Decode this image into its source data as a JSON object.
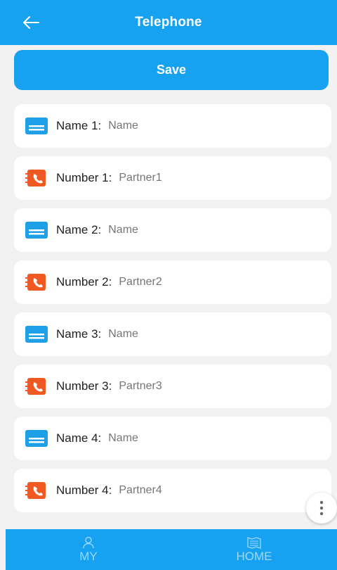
{
  "header": {
    "title": "Telephone",
    "back_icon": "arrow-left-icon"
  },
  "save_label": "Save",
  "rows": [
    {
      "type": "name",
      "label": "Name 1:",
      "value": "Name"
    },
    {
      "type": "number",
      "label": "Number 1:",
      "value": "Partner1"
    },
    {
      "type": "name",
      "label": "Name 2:",
      "value": "Name"
    },
    {
      "type": "number",
      "label": "Number 2:",
      "value": "Partner2"
    },
    {
      "type": "name",
      "label": "Name 3:",
      "value": "Name"
    },
    {
      "type": "number",
      "label": "Number 3:",
      "value": "Partner3"
    },
    {
      "type": "name",
      "label": "Name 4:",
      "value": "Name"
    },
    {
      "type": "number",
      "label": "Number 4:",
      "value": "Partner4"
    }
  ],
  "bottom_nav": [
    {
      "label": "MY",
      "icon": "user-icon"
    },
    {
      "label": "HOME",
      "icon": "home-icon"
    }
  ],
  "colors": {
    "primary": "#16a2f0",
    "name_icon": "#1ea0e8",
    "phone_icon": "#f05a22",
    "placeholder": "#a8a8a8",
    "background": "#f2f2f2"
  }
}
